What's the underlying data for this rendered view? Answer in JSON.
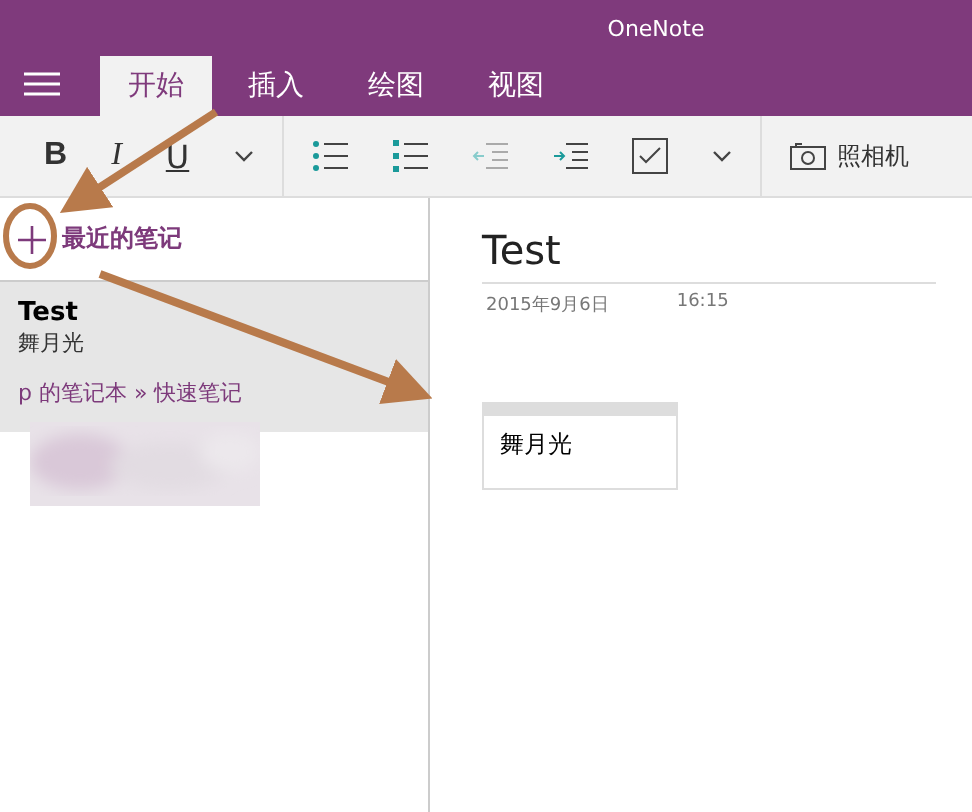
{
  "window": {
    "title": "OneNote"
  },
  "tabs": [
    {
      "label": "开始",
      "selected": true
    },
    {
      "label": "插入",
      "selected": false
    },
    {
      "label": "绘图",
      "selected": false
    },
    {
      "label": "视图",
      "selected": false
    }
  ],
  "toolbar": [
    {
      "kind": "bold",
      "label": "B"
    },
    {
      "kind": "italic",
      "label": "I"
    },
    {
      "kind": "underline",
      "label": "U"
    },
    {
      "kind": "dropdown"
    },
    {
      "kind": "bullets"
    },
    {
      "kind": "numbering"
    },
    {
      "kind": "outdent"
    },
    {
      "kind": "indent"
    },
    {
      "kind": "todo"
    },
    {
      "kind": "dropdown"
    },
    {
      "kind": "camera",
      "label": "照相机"
    }
  ],
  "section": {
    "title": "最近的笔记"
  },
  "notes": [
    {
      "title": "Test",
      "preview": "舞月光",
      "location": "p 的笔记本 » 快速笔记",
      "selected": true
    }
  ],
  "page": {
    "title": "Test",
    "date": "2015年9月6日",
    "time": "16:15",
    "note_text": "舞月光"
  }
}
